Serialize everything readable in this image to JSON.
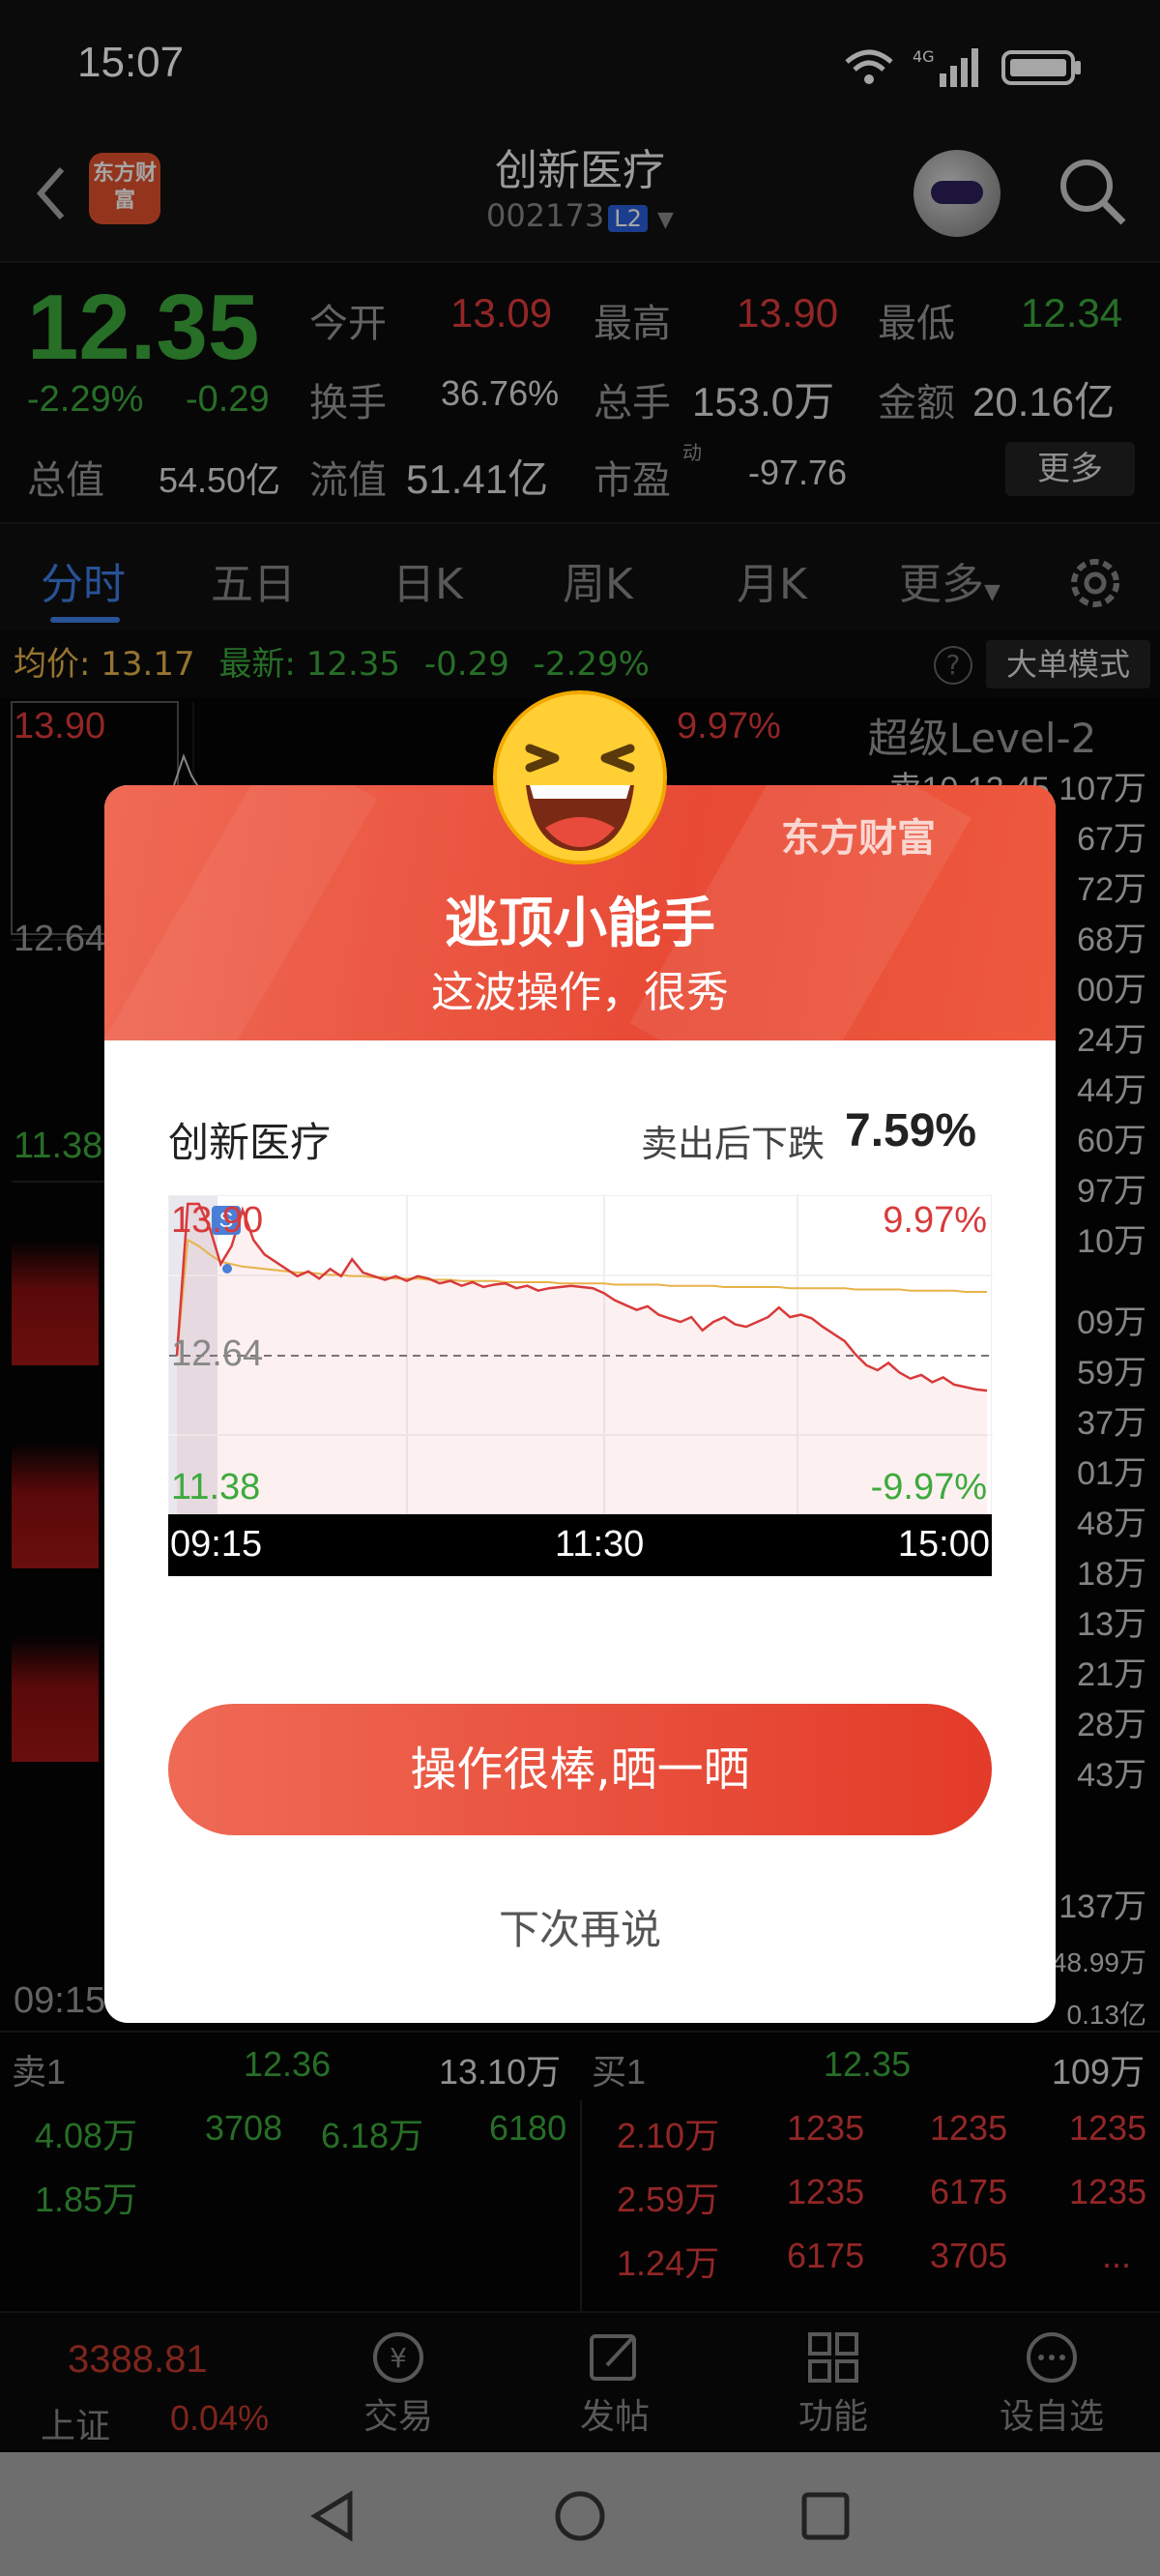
{
  "status": {
    "time": "15:07"
  },
  "header": {
    "logo": "东方财富",
    "stock_name": "创新医疗",
    "stock_code": "002173",
    "level_badge": "L2"
  },
  "quote": {
    "price": "12.35",
    "change_pct": "-2.29%",
    "change": "-0.29",
    "open_label": "今开",
    "open": "13.09",
    "high_label": "最高",
    "high": "13.90",
    "low_label": "最低",
    "low": "12.34",
    "turnover_label": "换手",
    "turnover": "36.76%",
    "volume_label": "总手",
    "volume": "153.0万",
    "amount_label": "金额",
    "amount": "20.16亿",
    "mcap_label": "总值",
    "mcap": "54.50亿",
    "float_label": "流值",
    "float": "51.41亿",
    "pe_label": "市盈",
    "pe_sup": "动",
    "pe": "-97.76",
    "more": "更多"
  },
  "tabs": [
    "分时",
    "五日",
    "日K",
    "周K",
    "月K",
    "更多"
  ],
  "avg_bar": {
    "avg_label": "均价:",
    "avg": "13.17",
    "latest_label": "最新:",
    "latest": "12.35",
    "chg": "-0.29",
    "pct": "-2.29%",
    "big_order": "大单模式"
  },
  "background": {
    "level2": "超级Level-2",
    "high": "13.90",
    "high_pct": "9.97%",
    "mid": "12.64",
    "low": "11.38",
    "time_start": "09:15",
    "orderbook": [
      "卖10  12.45  107万",
      "67万",
      "72万",
      "68万",
      "00万",
      "24万",
      "44万",
      "60万",
      "97万",
      "10万",
      "09万",
      "59万",
      "37万",
      "01万",
      "48万",
      "18万",
      "13万",
      "21万",
      "28万",
      "43万"
    ],
    "flows": [
      "137万",
      "48.99万",
      "0.13亿"
    ]
  },
  "trade": {
    "sell1_label": "卖1",
    "sell1_price": "12.36",
    "sell1_vol": "13.10万",
    "buy1_label": "买1",
    "buy1_price": "12.35",
    "buy1_vol": "109万",
    "left_rows": [
      [
        "4.08万",
        "3708",
        "6.18万",
        "6180"
      ],
      [
        "1.85万",
        "",
        "",
        ""
      ]
    ],
    "right_rows": [
      [
        "2.10万",
        "1235",
        "1235",
        "1235"
      ],
      [
        "2.59万",
        "1235",
        "6175",
        "1235"
      ],
      [
        "1.24万",
        "6175",
        "3705",
        "..."
      ]
    ]
  },
  "nav": {
    "index_value": "3388.81",
    "index_name": "上证",
    "index_pct": "0.04%",
    "items": [
      "交易",
      "发帖",
      "功能",
      "设自选"
    ]
  },
  "modal": {
    "brand": "东方财富",
    "title": "逃顶小能手",
    "subtitle": "这波操作，很秀",
    "stock_name": "创新医疗",
    "drop_label": "卖出后下跌",
    "drop_value": "7.59%",
    "chart": {
      "high": "13.90",
      "mid": "12.64",
      "low": "11.38",
      "high_pct": "9.97%",
      "low_pct": "-9.97%",
      "sell_marker": "S",
      "times": [
        "09:15",
        "11:30",
        "15:00"
      ]
    },
    "share_button": "操作很棒,晒一晒",
    "later_button": "下次再说"
  },
  "chart_data": {
    "type": "line",
    "title": "",
    "xlabel": "",
    "ylabel": "",
    "x_ticks": [
      "09:15",
      "11:30",
      "15:00"
    ],
    "ylim": [
      11.38,
      13.9
    ],
    "y_ticks": [
      "13.90",
      "12.64",
      "11.38"
    ],
    "right_ticks": [
      "9.97%",
      "-9.97%"
    ],
    "reference": 12.64,
    "series": [
      {
        "role": "price",
        "values": [
          12.64,
          13.9,
          13.9,
          13.7,
          13.4,
          13.55,
          13.85,
          13.6,
          13.48,
          13.42,
          13.36,
          13.3,
          13.34,
          13.28,
          13.36,
          13.3,
          13.44,
          13.33,
          13.3,
          13.27,
          13.3,
          13.26,
          13.3,
          13.28,
          13.24,
          13.26,
          13.22,
          13.25,
          13.21,
          13.23,
          13.24,
          13.2,
          13.22,
          13.18,
          13.2,
          13.21,
          13.22,
          13.21,
          13.2,
          13.16,
          13.1,
          13.06,
          13.02,
          13.05,
          12.98,
          12.95,
          12.92,
          12.96,
          12.85,
          12.92,
          12.96,
          12.9,
          12.88,
          12.92,
          12.96,
          13.04,
          12.96,
          12.98,
          12.95,
          12.88,
          12.82,
          12.76,
          12.65,
          12.56,
          12.52,
          12.58,
          12.5,
          12.45,
          12.48,
          12.42,
          12.46,
          12.4,
          12.38,
          12.36,
          12.35
        ],
        "color": "#d93a3a"
      },
      {
        "role": "avg",
        "values": [
          12.64,
          13.6,
          13.55,
          13.48,
          13.42,
          13.4,
          13.38,
          13.37,
          13.36,
          13.35,
          13.34,
          13.33,
          13.33,
          13.32,
          13.31,
          13.31,
          13.3,
          13.3,
          13.29,
          13.29,
          13.28,
          13.28,
          13.28,
          13.27,
          13.27,
          13.27,
          13.26,
          13.26,
          13.26,
          13.26,
          13.25,
          13.25,
          13.25,
          13.25,
          13.25,
          13.24,
          13.24,
          13.24,
          13.24,
          13.24,
          13.23,
          13.23,
          13.23,
          13.23,
          13.23,
          13.22,
          13.22,
          13.22,
          13.22,
          13.22,
          13.21,
          13.21,
          13.21,
          13.21,
          13.21,
          13.21,
          13.2,
          13.2,
          13.2,
          13.2,
          13.2,
          13.2,
          13.19,
          13.19,
          13.19,
          13.19,
          13.19,
          13.18,
          13.18,
          13.18,
          13.18,
          13.18,
          13.17,
          13.17,
          13.17
        ],
        "color": "#e8b34a"
      }
    ]
  }
}
